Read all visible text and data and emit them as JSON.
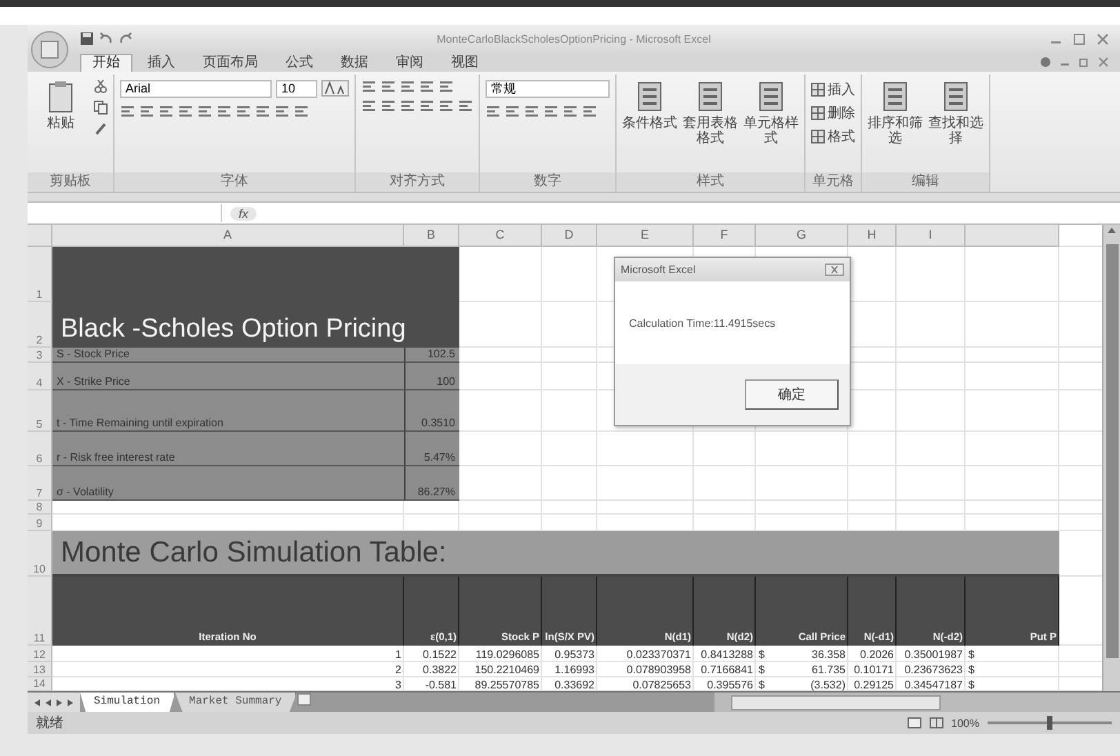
{
  "window": {
    "title": "MonteCarloBlackScholesOptionPricing - Microsoft Excel"
  },
  "tabs": [
    {
      "label": "开始",
      "selected": true
    },
    {
      "label": "插入",
      "selected": false
    },
    {
      "label": "页面布局",
      "selected": false
    },
    {
      "label": "公式",
      "selected": false
    },
    {
      "label": "数据",
      "selected": false
    },
    {
      "label": "审阅",
      "selected": false
    },
    {
      "label": "视图",
      "selected": false
    }
  ],
  "ribbon": {
    "groups": [
      {
        "kind": "clipboard",
        "label": "剪贴板",
        "commands": [
          {
            "label": "粘贴"
          }
        ]
      },
      {
        "kind": "font",
        "label": "字体",
        "font_name": "Arial",
        "font_size": "10"
      },
      {
        "kind": "alignment",
        "label": "对齐方式"
      },
      {
        "kind": "number",
        "label": "数字",
        "format": "常规"
      },
      {
        "kind": "styles",
        "label": "样式",
        "commands": [
          {
            "label": "条件格式"
          },
          {
            "label": "套用表格格式"
          },
          {
            "label": "单元格样式"
          }
        ]
      },
      {
        "kind": "cells",
        "label": "单元格",
        "commands": [
          {
            "label": "插入"
          },
          {
            "label": "删除"
          },
          {
            "label": "格式"
          }
        ]
      },
      {
        "kind": "editing",
        "label": "编辑",
        "commands": [
          {
            "label": "排序和筛选"
          },
          {
            "label": "查找和选择"
          }
        ]
      }
    ]
  },
  "formula_bar": {
    "function_label": "fx"
  },
  "sheet": {
    "columns": [
      "A",
      "B",
      "C",
      "D",
      "E",
      "F",
      "G",
      "H",
      "I"
    ],
    "row_numbers": [
      "1",
      "2",
      "3",
      "4",
      "5",
      "6",
      "7",
      "8",
      "9",
      "10",
      "11",
      "12",
      "13",
      "14"
    ],
    "title": "Black -Scholes Option Pricing",
    "inputs": [
      {
        "label": "S - Stock Price",
        "value": "102.5"
      },
      {
        "label": "X - Strike Price",
        "value": "100"
      },
      {
        "label": "t - Time Remaining until expiration",
        "value": "0.3510"
      },
      {
        "label": "r - Risk free interest rate",
        "value": "5.47%"
      },
      {
        "label": "σ - Volatility",
        "value": "86.27%"
      }
    ],
    "table_title": "Monte Carlo Simulation Table:",
    "table_columns": [
      "Iteration No",
      "ε(0,1)",
      "Stock P",
      "ln(S/X PV)",
      "N(d1)",
      "N(d2)",
      "Call Price",
      "N(-d1)",
      "N(-d2)",
      "Put P"
    ],
    "table_rows": [
      [
        "1",
        "0.1522",
        "119.0296085",
        "0.95373",
        "0.023370371",
        "0.8413288",
        "$",
        "36.358",
        "0.2026",
        "0.35001987",
        "$"
      ],
      [
        "2",
        "0.3822",
        "150.2210469",
        "1.16993",
        "0.078903958",
        "0.7166841",
        "$",
        "61.735",
        "0.10171",
        "0.23673623",
        "$"
      ],
      [
        "3",
        "-0.581",
        "89.25570785",
        "0.33692",
        "0.07825653",
        "0.395576",
        "$",
        "(3.532)",
        "0.29125",
        "0.34547187",
        "$"
      ]
    ]
  },
  "dialog": {
    "title": "Microsoft Excel",
    "message": "Calculation Time:11.4915secs",
    "button": "确定"
  },
  "sheet_tabs": [
    {
      "label": "Simulation",
      "selected": true
    },
    {
      "label": "Market Summary",
      "selected": false
    }
  ],
  "status_bar": {
    "text": "就绪",
    "zoom": "100%",
    "zoom_slider": {
      "level": 0.5
    }
  }
}
